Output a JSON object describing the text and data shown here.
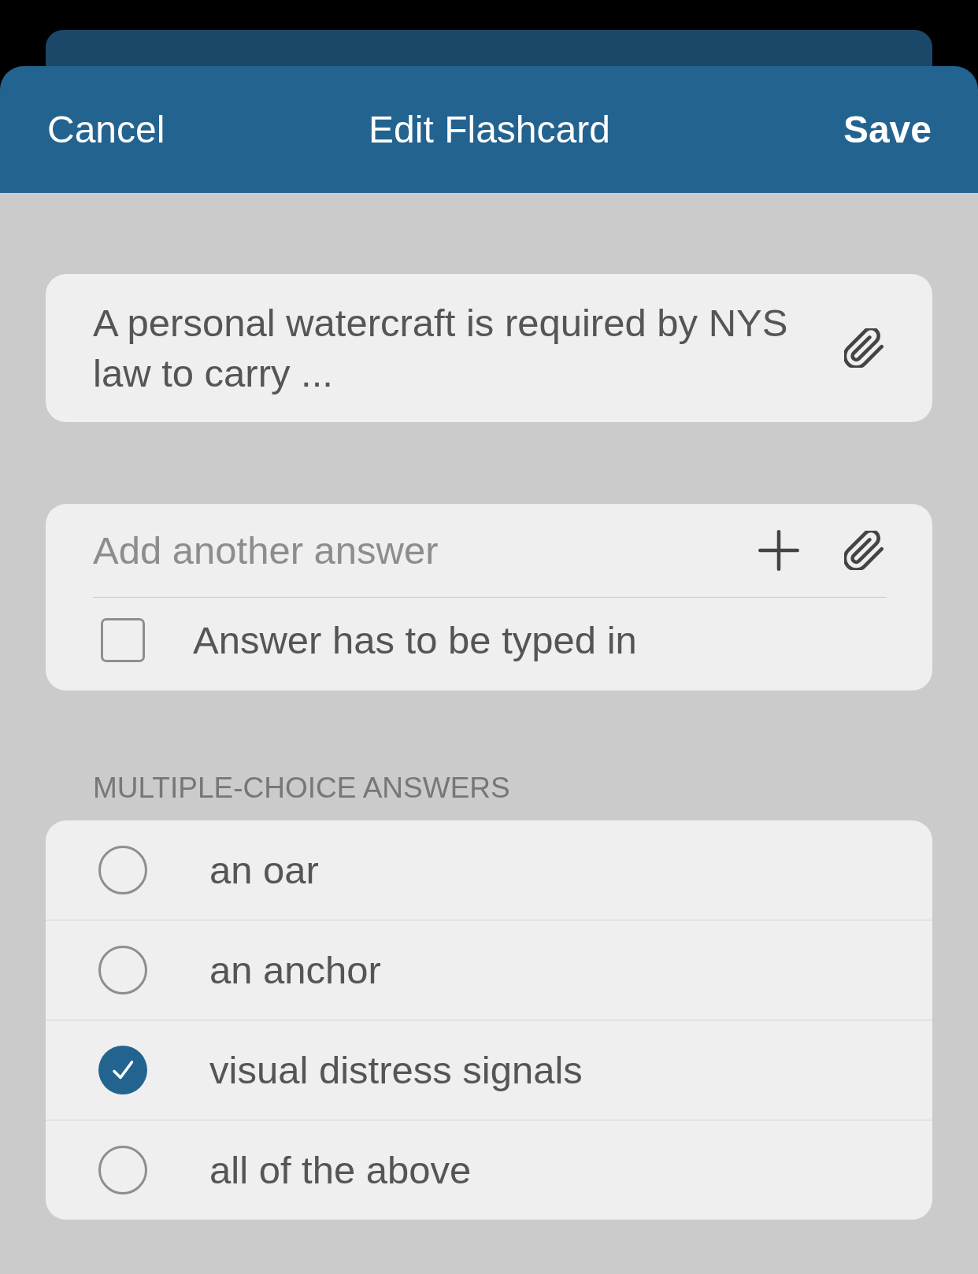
{
  "header": {
    "cancel_label": "Cancel",
    "title": "Edit Flashcard",
    "save_label": "Save"
  },
  "question": {
    "value": "A personal watercraft is required by NYS law to carry ..."
  },
  "new_answer": {
    "placeholder": "Add another answer",
    "typed_in": {
      "label": "Answer has to be typed in",
      "checked": false
    }
  },
  "multiple_choice": {
    "title": "MULTIPLE-CHOICE ANSWERS",
    "answers": [
      {
        "text": "an oar",
        "selected": false
      },
      {
        "text": "an anchor",
        "selected": false
      },
      {
        "text": "visual distress signals",
        "selected": true
      },
      {
        "text": "all of the above",
        "selected": false
      }
    ]
  }
}
